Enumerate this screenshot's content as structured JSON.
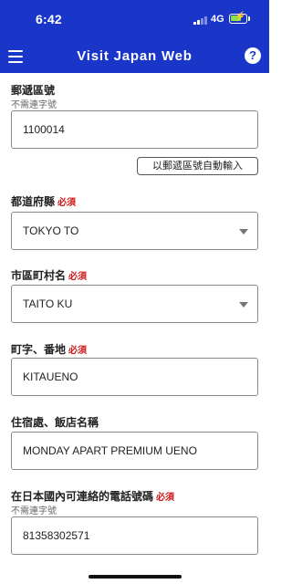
{
  "status_bar": {
    "time": "6:42",
    "network": "4G",
    "battery_level": 0.7,
    "battery_charging": true,
    "colors": {
      "bar": "#1a36c9",
      "battery": "#8be04e"
    }
  },
  "header": {
    "title": "Visit Japan Web",
    "help_icon": "?",
    "menu_icon": "hamburger-icon"
  },
  "form": {
    "postal_code": {
      "label": "郵遞區號",
      "hint": "不需連字號",
      "value": "1100014"
    },
    "autofill_button": "以郵遞區號自動輸入",
    "prefecture": {
      "label": "都道府縣",
      "required": "必須",
      "value": "TOKYO TO"
    },
    "city": {
      "label": "市區町村名",
      "required": "必須",
      "value": "TAITO KU"
    },
    "street": {
      "label": "町字、番地",
      "required": "必須",
      "value": "KITAUENO"
    },
    "hotel": {
      "label": "住宿處、飯店名稱",
      "value": "MONDAY APART PREMIUM UENO"
    },
    "phone": {
      "label": "在日本國內可連絡的電話號碼",
      "required": "必須",
      "hint": "不需連字號",
      "value": "81358302571"
    }
  },
  "colors": {
    "accent": "#1a36c9",
    "required": "#d01818"
  }
}
